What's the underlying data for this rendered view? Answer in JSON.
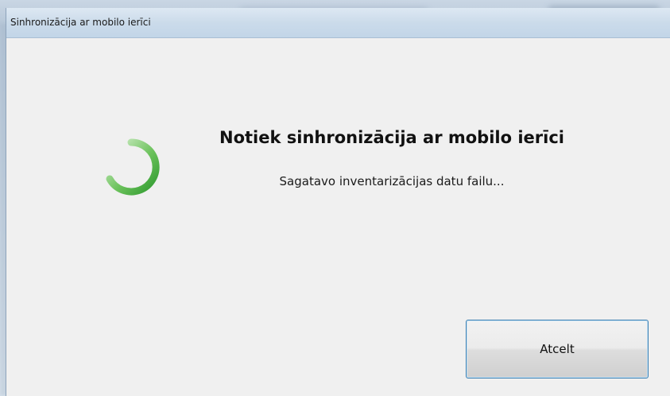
{
  "window": {
    "title": "Sinhronizācija ar mobilo ierīci"
  },
  "dialog": {
    "heading": "Notiek sinhronizācija ar mobilo ierīci",
    "status": "Sagatavo inventarizācijas datu failu..."
  },
  "buttons": {
    "cancel_label": "Atcelt"
  },
  "icons": {
    "spinner": "loading-spinner-icon"
  },
  "colors": {
    "spinner_light": "#bfe7b4",
    "spinner_dark": "#2f9a2f",
    "button_border": "#3c7fb1"
  }
}
